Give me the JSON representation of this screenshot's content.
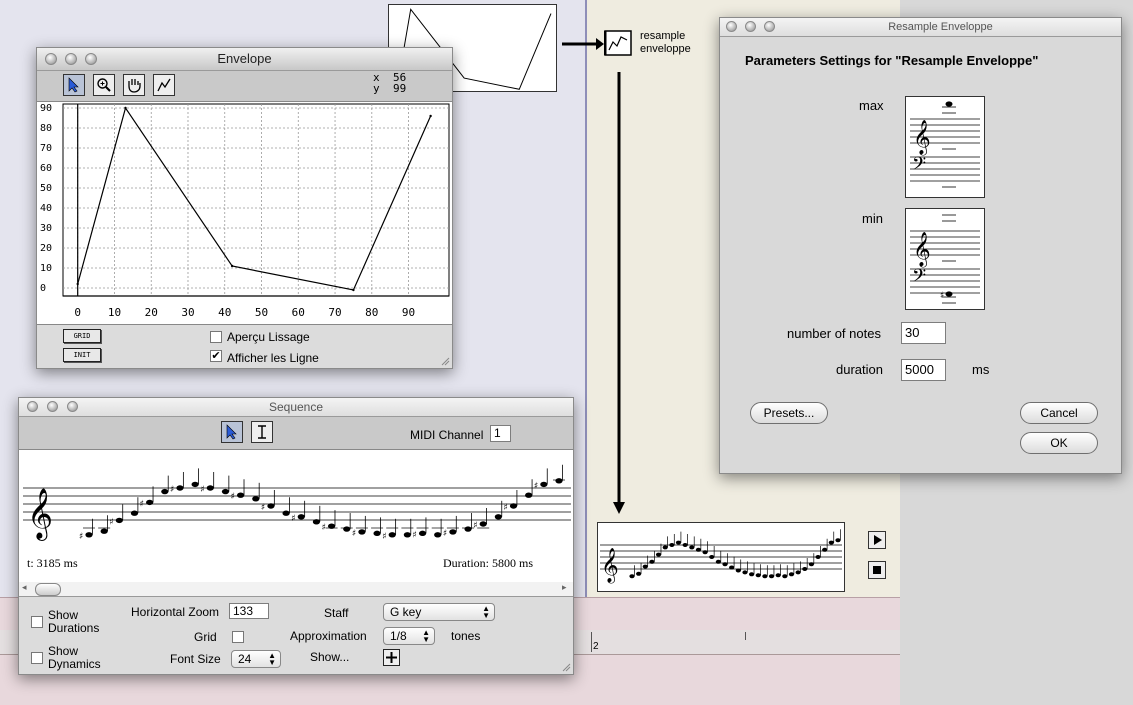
{
  "envelope": {
    "title": "Envelope",
    "cursor_x_label": "x",
    "cursor_x_value": "56",
    "cursor_y_label": "y",
    "cursor_y_value": "99",
    "y_ticks": [
      "90",
      "80",
      "70",
      "60",
      "50",
      "40",
      "30",
      "20",
      "10",
      "0"
    ],
    "x_ticks": [
      "0",
      "10",
      "20",
      "30",
      "40",
      "50",
      "60",
      "70",
      "80",
      "90"
    ],
    "grid_button": "GRID",
    "init_button": "INIT",
    "apercu_label": "Aperçu Lissage",
    "apercu_checked": false,
    "afficher_label": "Afficher les Ligne",
    "afficher_checked": true,
    "tools": [
      "arrow-tool",
      "zoom-tool",
      "hand-tool",
      "curve-tool"
    ]
  },
  "chart_data": {
    "type": "line",
    "x": [
      0,
      13,
      42,
      75,
      96
    ],
    "y": [
      2,
      90,
      11,
      -1,
      86
    ],
    "xlim": [
      -4,
      101
    ],
    "ylim": [
      -4,
      92
    ],
    "x_ticks": [
      0,
      10,
      20,
      30,
      40,
      50,
      60,
      70,
      80,
      90
    ],
    "y_ticks": [
      0,
      10,
      20,
      30,
      40,
      50,
      60,
      70,
      80,
      90
    ],
    "grid": true
  },
  "patch": {
    "resample_label_line1": "resample",
    "resample_label_line2": "enveloppe",
    "thumb_points": [
      [
        0.05,
        0.95
      ],
      [
        0.13,
        0.05
      ],
      [
        0.45,
        0.85
      ],
      [
        0.78,
        0.98
      ],
      [
        0.97,
        0.1
      ]
    ]
  },
  "resample_dialog": {
    "title": "Resample Enveloppe",
    "heading": "Parameters Settings for \"Resample Enveloppe\"",
    "max_label": "max",
    "min_label": "min",
    "num_notes_label": "number of notes",
    "num_notes_value": "30",
    "duration_label": "duration",
    "duration_value": "5000",
    "duration_unit": "ms",
    "presets_button": "Presets...",
    "cancel_button": "Cancel",
    "ok_button": "OK"
  },
  "sequence": {
    "title": "Sequence",
    "midi_channel_label": "MIDI Channel",
    "midi_channel_value": "1",
    "time_text": "t: 3185 ms",
    "duration_text": "Duration: 5800 ms",
    "show_durations_line1": "Show",
    "show_durations_line2": "Durations",
    "show_dynamics_line1": "Show",
    "show_dynamics_line2": "Dynamics",
    "hzoom_label": "Horizontal Zoom",
    "hzoom_value": "133",
    "grid_label": "Grid",
    "font_size_label": "Font Size",
    "font_size_value": "24",
    "staff_label": "Staff",
    "staff_value": "G key",
    "approx_label": "Approximation",
    "approx_value": "1/8",
    "tones_label": "tones",
    "show_label": "Show...",
    "melody": [
      0.9,
      0.85,
      0.7,
      0.6,
      0.45,
      0.3,
      0.25,
      0.2,
      0.25,
      0.3,
      0.35,
      0.4,
      0.5,
      0.6,
      0.65,
      0.72,
      0.78,
      0.82,
      0.86,
      0.88,
      0.9,
      0.9,
      0.88,
      0.9,
      0.86,
      0.82,
      0.75,
      0.65,
      0.5,
      0.35,
      0.2,
      0.15
    ]
  },
  "timeline": {
    "marker_label": "2"
  },
  "player": {
    "play_icon": "play-icon",
    "stop_icon": "stop-icon"
  }
}
